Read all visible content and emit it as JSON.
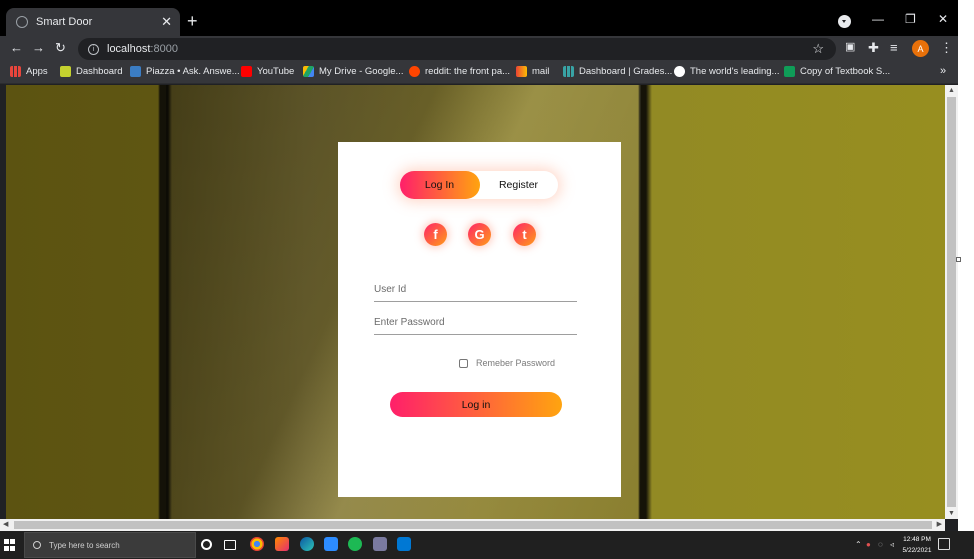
{
  "browser": {
    "tab_title": "Smart Door",
    "tab_close": "✕",
    "new_tab": "+",
    "url_host": "localhost",
    "url_port": ":8000",
    "profile_initial": "A",
    "window_controls": {
      "minimize": "—",
      "restore": "❐",
      "close": "✕"
    }
  },
  "bookmarks": [
    {
      "label": "Apps",
      "color": "#e8453c"
    },
    {
      "label": "Dashboard",
      "color": "#c4d12f"
    },
    {
      "label": "Piazza • Ask. Answe...",
      "color": "#3b7dc4"
    },
    {
      "label": "YouTube",
      "color": "#ff0000"
    },
    {
      "label": "My Drive - Google...",
      "color": "#1fa463"
    },
    {
      "label": "reddit: the front pa...",
      "color": "#ff4500"
    },
    {
      "label": "mail",
      "color": "#ea4335"
    },
    {
      "label": "Dashboard | Grades...",
      "color": "#38a3a5"
    },
    {
      "label": "The world's leading...",
      "color": "#ffffff"
    },
    {
      "label": "Copy of Textbook S...",
      "color": "#0f9d58"
    }
  ],
  "login": {
    "tab_login": "Log In",
    "tab_register": "Register",
    "social": [
      "f",
      "G",
      "t"
    ],
    "userid_placeholder": "User Id",
    "password_placeholder": "Enter Password",
    "remember_label": "Remeber Password",
    "submit_label": "Log in"
  },
  "taskbar": {
    "search_placeholder": "Type here to search",
    "time": "12:48 PM",
    "date": "5/22/2021"
  },
  "colors": {
    "gradient_start": "#ff1f6a",
    "gradient_end": "#ffa40f"
  }
}
